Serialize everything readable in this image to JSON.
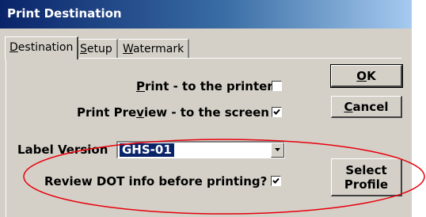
{
  "window": {
    "title": "Print Destination"
  },
  "tabs": [
    {
      "label_pre": "",
      "label_key": "D",
      "label_post": "estination"
    },
    {
      "label_pre": "",
      "label_key": "S",
      "label_post": "etup"
    },
    {
      "label_pre": "",
      "label_key": "W",
      "label_post": "atermark"
    }
  ],
  "destination": {
    "print_printer": {
      "label_key": "P",
      "label_post": "rint - to the printer",
      "checked": false
    },
    "print_preview": {
      "label_pre": "Print Pre",
      "label_key": "v",
      "label_post": "iew - to the screen",
      "checked": true
    },
    "label_version": {
      "label": "Label Version",
      "value": "GHS-01"
    },
    "review_dot": {
      "label": "Review DOT info before printing?",
      "checked": true
    }
  },
  "buttons": {
    "ok": {
      "label_key": "O",
      "label_post": "K"
    },
    "cancel": {
      "label_key": "C",
      "label_post": "ancel"
    },
    "select_profile": {
      "line1": "Select",
      "line2": "Profile"
    }
  },
  "annotation": {
    "color": "#e8000b"
  }
}
